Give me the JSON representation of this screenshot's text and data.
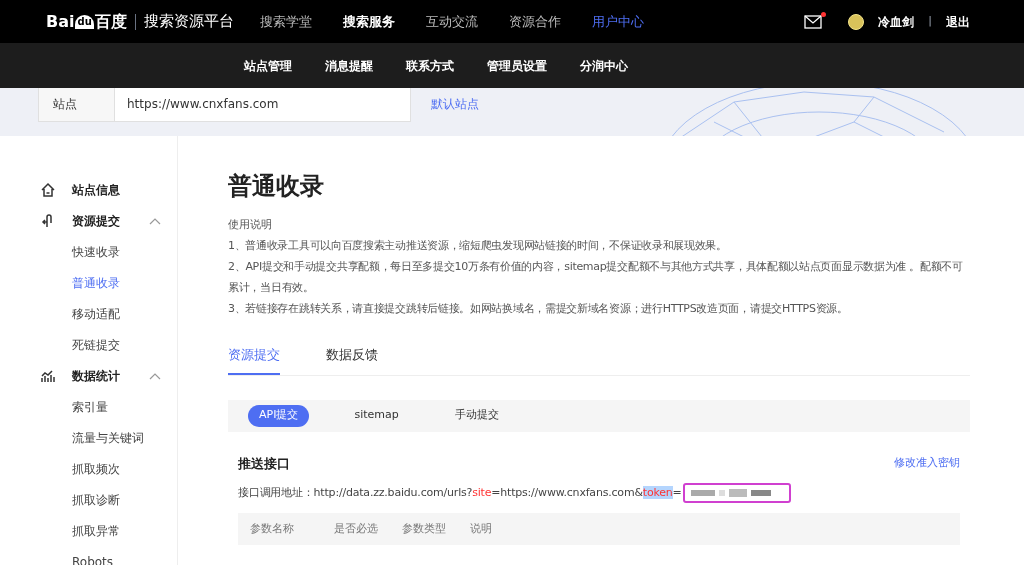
{
  "header": {
    "logo": {
      "left": "Bai",
      "paw": "du",
      "right": "百度"
    },
    "platform": "搜索资源平台",
    "nav": [
      {
        "label": "搜索学堂",
        "selected": false,
        "bold": false
      },
      {
        "label": "搜索服务",
        "selected": false,
        "bold": true
      },
      {
        "label": "互动交流",
        "selected": false,
        "bold": false
      },
      {
        "label": "资源合作",
        "selected": false,
        "bold": false
      },
      {
        "label": "用户中心",
        "selected": true,
        "bold": false
      }
    ],
    "unread": true,
    "user": "冷血剑",
    "separator": "|",
    "logout": "退出"
  },
  "subnav": [
    "站点管理",
    "消息提醒",
    "联系方式",
    "管理员设置",
    "分润中心"
  ],
  "site_bar": {
    "type_label": "站点",
    "site": "https://www.cnxfans.com",
    "default_link": "默认站点"
  },
  "sidebar": [
    {
      "label": "站点信息"
    },
    {
      "label": "资源提交",
      "expanded": true,
      "children": [
        {
          "label": "快速收录",
          "selected": false
        },
        {
          "label": "普通收录",
          "selected": true
        },
        {
          "label": "移动适配",
          "selected": false
        },
        {
          "label": "死链提交",
          "selected": false
        }
      ]
    },
    {
      "label": "数据统计",
      "expanded": true,
      "children": [
        {
          "label": "索引量",
          "selected": false
        },
        {
          "label": "流量与关键词",
          "selected": false
        },
        {
          "label": "抓取频次",
          "selected": false
        },
        {
          "label": "抓取诊断",
          "selected": false
        },
        {
          "label": "抓取异常",
          "selected": false
        },
        {
          "label": "Robots",
          "selected": false
        }
      ]
    }
  ],
  "page_title": "普通收录",
  "instructions": {
    "title": "使用说明",
    "items": [
      "1、普通收录工具可以向百度搜索主动推送资源，缩短爬虫发现网站链接的时间，不保证收录和展现效果。",
      "2、API提交和手动提交共享配额，每日至多提交10万条有价值的内容，sitemap提交配额不与其他方式共享，具体配额以站点页面显示数据为准 。配额不可累计，当日有效。",
      "3、若链接存在跳转关系，请直接提交跳转后链接。如网站换域名，需提交新域名资源；进行HTTPS改造页面，请提交HTTPS资源。"
    ]
  },
  "tabs": [
    {
      "label": "资源提交",
      "selected": true
    },
    {
      "label": "数据反馈",
      "selected": false
    }
  ],
  "methods": [
    {
      "label": "API提交",
      "selected": true
    },
    {
      "label": "sitemap",
      "selected": false
    },
    {
      "label": "手动提交",
      "selected": false
    }
  ],
  "push": {
    "title": "推送接口",
    "modify_link": "修改准入密钥",
    "url_parts": [
      {
        "kind": "plain",
        "text": "接口调用地址：http://data.zz.baidu.com/urls?",
        "highlighted": false
      },
      {
        "kind": "param",
        "text": "site",
        "highlighted": false
      },
      {
        "kind": "plain",
        "text": "=https://www.cnxfans.com&",
        "highlighted": false
      },
      {
        "kind": "param",
        "text": "token",
        "highlighted": true
      },
      {
        "kind": "plain",
        "text": "=",
        "highlighted": false
      }
    ],
    "token_redacted": true,
    "columns": [
      "参数名称",
      "是否必选",
      "参数类型",
      "说明"
    ]
  }
}
